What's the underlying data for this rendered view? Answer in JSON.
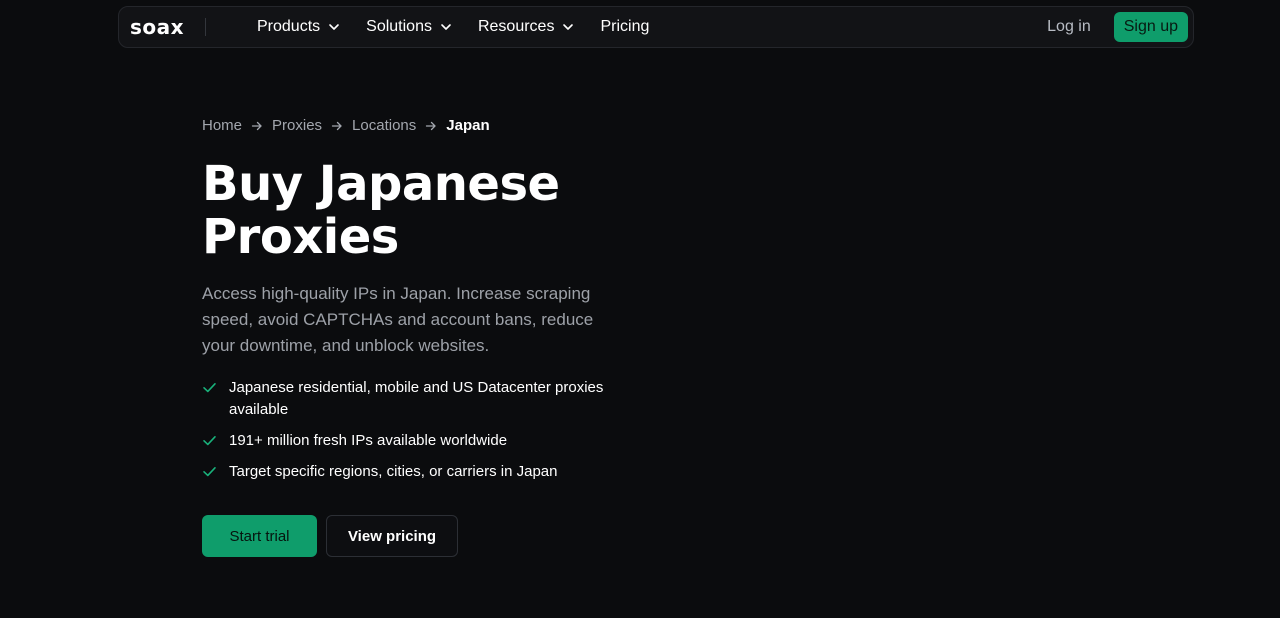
{
  "colors": {
    "background": "#0b0c0e",
    "nav_background": "#121316",
    "accent": "#0f9d6b",
    "muted_text": "#9da1a8",
    "check": "#19b27b"
  },
  "nav": {
    "logo": "soax",
    "menu": [
      {
        "label": "Products",
        "icon": "chevron-down-icon"
      },
      {
        "label": "Solutions",
        "icon": "chevron-down-icon"
      },
      {
        "label": "Resources",
        "icon": "chevron-down-icon"
      },
      {
        "label": "Pricing"
      }
    ],
    "login": "Log in",
    "signup": "Sign up"
  },
  "breadcrumb": {
    "items": [
      "Home",
      "Proxies",
      "Locations",
      "Japan"
    ],
    "separator_icon": "arrow-right-icon"
  },
  "hero": {
    "title": "Buy Japanese Proxies",
    "description": "Access high-quality IPs in Japan. Increase scraping speed, avoid CAPTCHAs and account bans, reduce your downtime, and unblock websites.",
    "features": [
      "Japanese residential, mobile and US Datacenter proxies available",
      "191+ million fresh IPs available worldwide",
      "Target specific regions, cities, or carriers in Japan"
    ],
    "feature_icon": "checkmark-icon",
    "cta_primary": "Start trial",
    "cta_secondary": "View pricing"
  }
}
